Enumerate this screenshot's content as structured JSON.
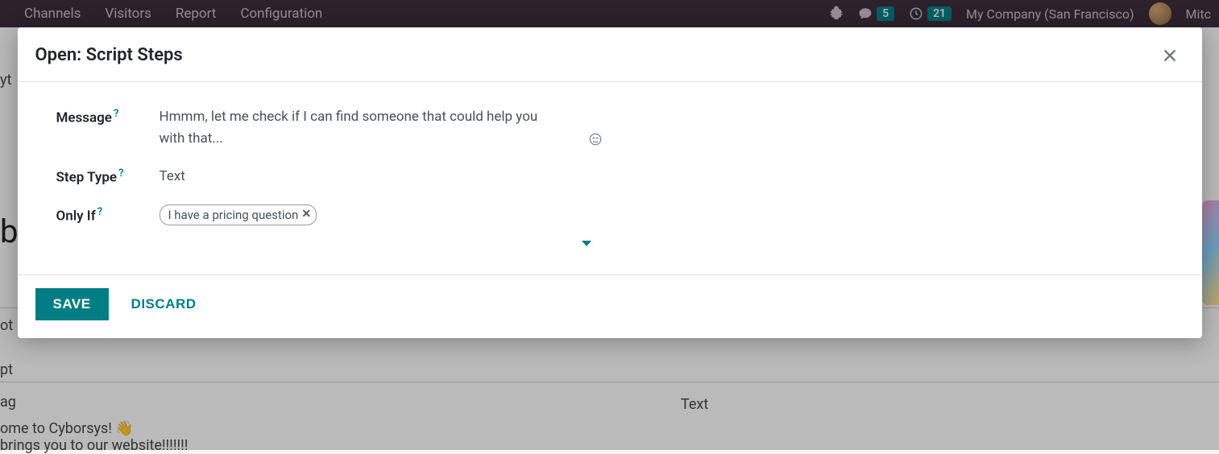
{
  "nav": {
    "items": [
      "Channels",
      "Visitors",
      "Report",
      "Configuration"
    ],
    "chat_badge": "5",
    "clock_badge": "21",
    "company": "My Company (San Francisco)",
    "user": "Mitc"
  },
  "background": {
    "row1": "yt",
    "row_big": "b",
    "row2": "ot",
    "row3": "pt",
    "row4": "ag",
    "row5_a": "ome to Cyborsys! 👋",
    "row5_b": " brings you to our website!!!!!!!",
    "row6": "Text"
  },
  "modal": {
    "title": "Open: Script Steps",
    "labels": {
      "message": "Message",
      "step_type": "Step Type",
      "only_if": "Only If"
    },
    "values": {
      "message": "Hmmm, let me check if I can find someone that could help you with that...",
      "step_type": "Text",
      "only_if_tag": "I have a pricing question"
    },
    "buttons": {
      "save": "SAVE",
      "discard": "DISCARD"
    }
  }
}
